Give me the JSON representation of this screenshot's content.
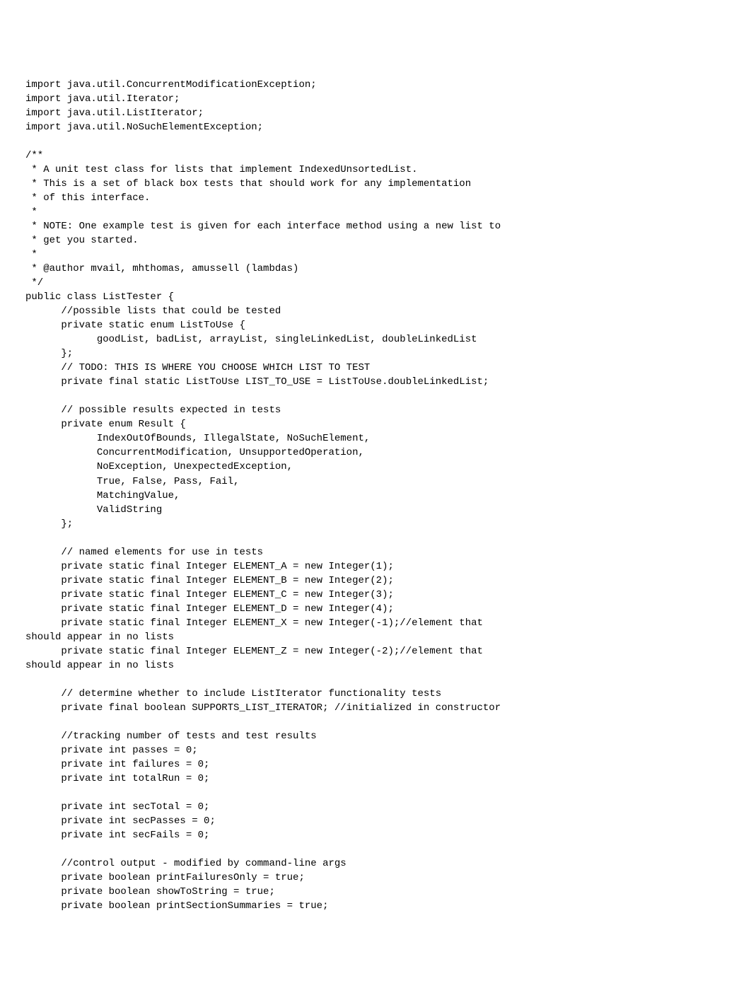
{
  "code": {
    "lines": [
      "import java.util.ConcurrentModificationException;",
      "import java.util.Iterator;",
      "import java.util.ListIterator;",
      "import java.util.NoSuchElementException;",
      "",
      "/**",
      " * A unit test class for lists that implement IndexedUnsortedList.",
      " * This is a set of black box tests that should work for any implementation",
      " * of this interface.",
      " * ",
      " * NOTE: One example test is given for each interface method using a new list to",
      " * get you started.",
      " * ",
      " * @author mvail, mhthomas, amussell (lambdas)",
      " */",
      "public class ListTester {",
      "      //possible lists that could be tested",
      "      private static enum ListToUse {",
      "            goodList, badList, arrayList, singleLinkedList, doubleLinkedList",
      "      };",
      "      // TODO: THIS IS WHERE YOU CHOOSE WHICH LIST TO TEST",
      "      private final static ListToUse LIST_TO_USE = ListToUse.doubleLinkedList;",
      "",
      "      // possible results expected in tests",
      "      private enum Result {",
      "            IndexOutOfBounds, IllegalState, NoSuchElement,",
      "            ConcurrentModification, UnsupportedOperation,",
      "            NoException, UnexpectedException,",
      "            True, False, Pass, Fail,",
      "            MatchingValue,",
      "            ValidString",
      "      };",
      "",
      "      // named elements for use in tests",
      "      private static final Integer ELEMENT_A = new Integer(1);",
      "      private static final Integer ELEMENT_B = new Integer(2);",
      "      private static final Integer ELEMENT_C = new Integer(3);",
      "      private static final Integer ELEMENT_D = new Integer(4);",
      "      private static final Integer ELEMENT_X = new Integer(-1);//element that ",
      "should appear in no lists",
      "      private static final Integer ELEMENT_Z = new Integer(-2);//element that ",
      "should appear in no lists",
      "",
      "      // determine whether to include ListIterator functionality tests",
      "      private final boolean SUPPORTS_LIST_ITERATOR; //initialized in constructor",
      "",
      "      //tracking number of tests and test results",
      "      private int passes = 0;",
      "      private int failures = 0;",
      "      private int totalRun = 0;",
      "",
      "      private int secTotal = 0;",
      "      private int secPasses = 0;",
      "      private int secFails = 0;",
      "",
      "      //control output - modified by command-line args",
      "      private boolean printFailuresOnly = true;",
      "      private boolean showToString = true;",
      "      private boolean printSectionSummaries = true;"
    ]
  }
}
